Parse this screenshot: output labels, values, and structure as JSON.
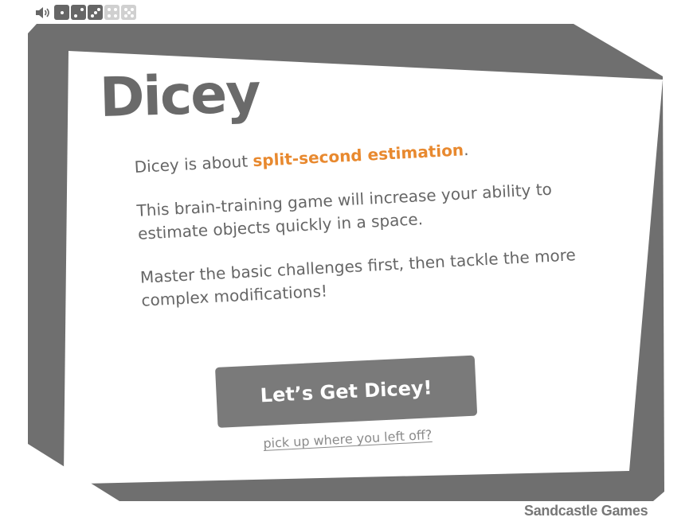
{
  "toolbar": {
    "sound_icon": "speaker-icon",
    "levels": [
      {
        "pips": 1,
        "state": "active"
      },
      {
        "pips": 2,
        "state": "active"
      },
      {
        "pips": 3,
        "state": "active"
      },
      {
        "pips": 4,
        "state": "locked"
      },
      {
        "pips": 5,
        "state": "locked"
      }
    ]
  },
  "intro": {
    "title": "Dicey",
    "line1_prefix": "Dicey is about ",
    "line1_highlight": "split-second estimation",
    "line1_suffix": ".",
    "paragraph2": "This brain-training game will increase your ability to estimate objects quickly in a space.",
    "paragraph3": "Master the basic challenges first, then tackle the more complex modifications!",
    "play_button": "Let’s Get Dicey!",
    "resume_link": "pick up where you left off?"
  },
  "footer": {
    "studio": "Sandcastle Games"
  },
  "colors": {
    "frame": "#6f6f6f",
    "card": "#ffffff",
    "text": "#666666",
    "accent": "#e8892f",
    "button": "#7a7a7a"
  }
}
